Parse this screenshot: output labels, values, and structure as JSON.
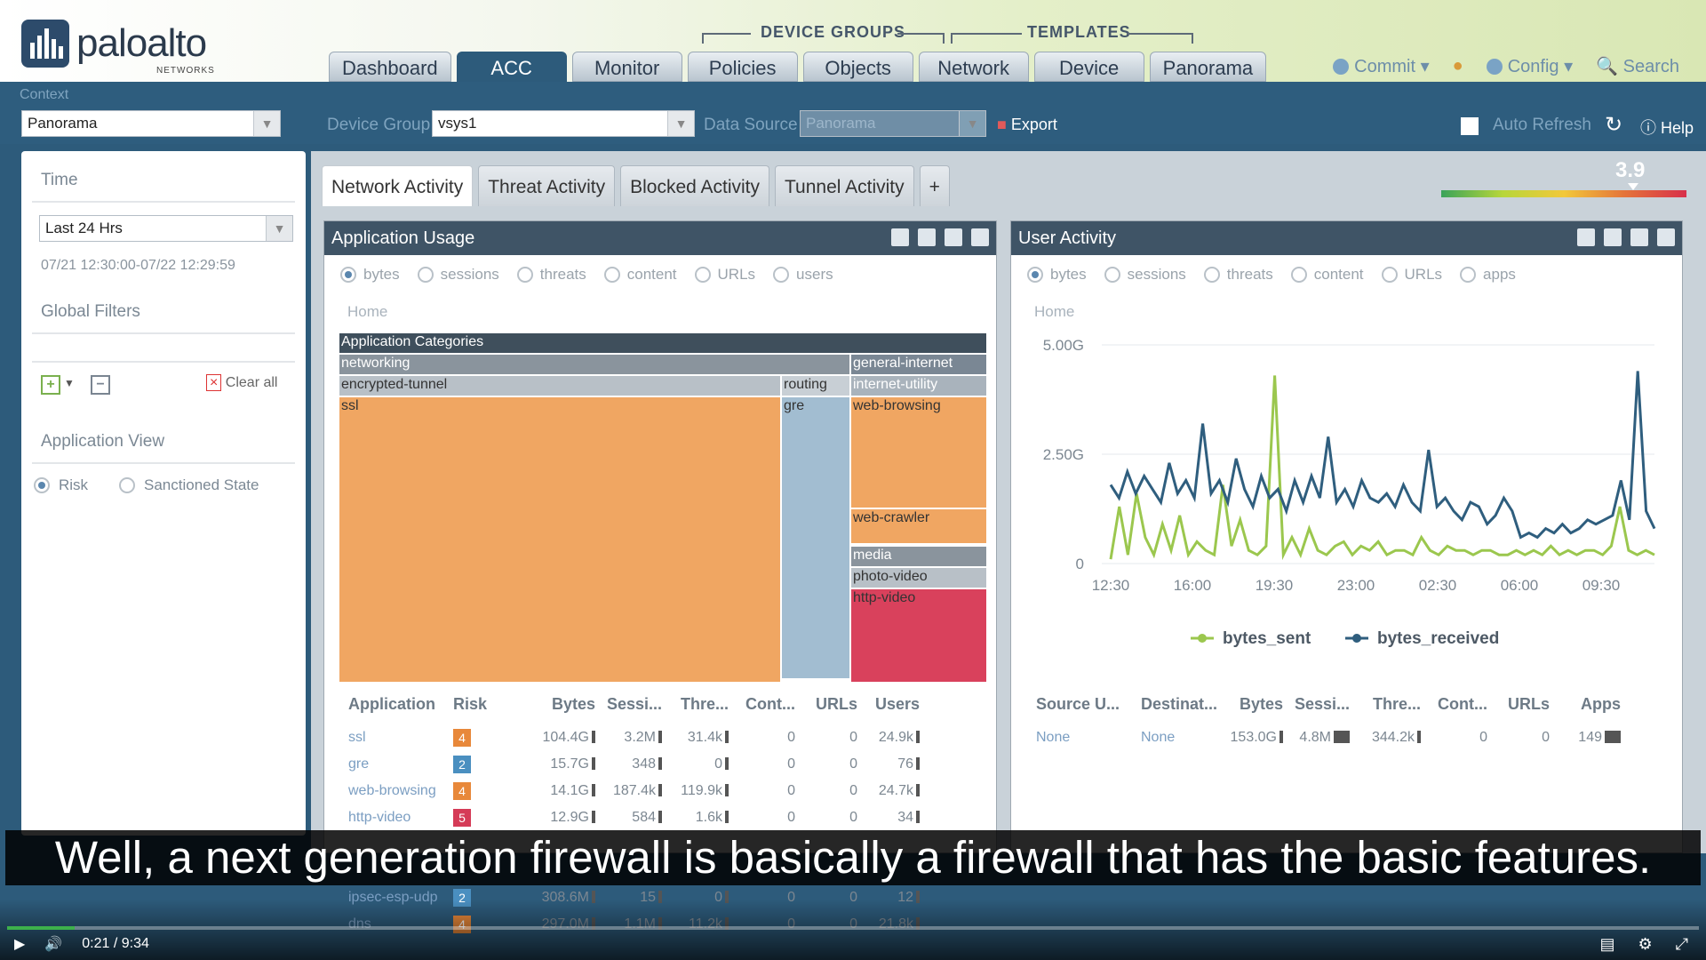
{
  "logo": {
    "name": "paloalto",
    "sub": "NETWORKS"
  },
  "groups": {
    "device_groups": "DEVICE GROUPS",
    "templates": "TEMPLATES"
  },
  "nav": [
    "Dashboard",
    "ACC",
    "Monitor",
    "Policies",
    "Objects",
    "Network",
    "Device",
    "Panorama"
  ],
  "nav_active": 1,
  "header_actions": {
    "commit": "Commit",
    "config": "Config",
    "search": "Search"
  },
  "context": {
    "label": "Context",
    "value": "Panorama"
  },
  "device_group": {
    "label": "Device Group",
    "value": "vsys1"
  },
  "data_source": {
    "label": "Data Source",
    "value": "Panorama"
  },
  "export_label": "Export",
  "auto_refresh_label": "Auto Refresh",
  "help_label": "Help",
  "left": {
    "time_label": "Time",
    "time_value": "Last 24 Hrs",
    "time_range": "07/21 12:30:00-07/22 12:29:59",
    "filters_label": "Global Filters",
    "clear_all": "Clear all",
    "app_view_label": "Application View",
    "risk": "Risk",
    "sanctioned": "Sanctioned State"
  },
  "subtabs": [
    "Network Activity",
    "Threat Activity",
    "Blocked Activity",
    "Tunnel Activity"
  ],
  "add_tab": "+",
  "risk_score": "3.9",
  "app_usage": {
    "title": "Application Usage",
    "radios": [
      "bytes",
      "sessions",
      "threats",
      "content",
      "URLs",
      "users"
    ],
    "home": "Home",
    "treemap": {
      "title": "Application Categories",
      "networking": "networking",
      "general_internet": "general-internet",
      "encrypted_tunnel": "encrypted-tunnel",
      "routing": "routing",
      "internet_utility": "internet-utility",
      "ssl": "ssl",
      "gre": "gre",
      "web_browsing": "web-browsing",
      "web_crawler": "web-crawler",
      "media": "media",
      "photo_video": "photo-video",
      "http_video": "http-video"
    },
    "columns": [
      "Application",
      "Risk",
      "Bytes",
      "Sessi...",
      "Thre...",
      "Cont...",
      "URLs",
      "Users"
    ],
    "rows": [
      {
        "app": "ssl",
        "risk": "4",
        "bytes": "104.4G",
        "sessions": "3.2M",
        "threats": "31.4k",
        "content": "0",
        "urls": "0",
        "users": "24.9k"
      },
      {
        "app": "gre",
        "risk": "2",
        "bytes": "15.7G",
        "sessions": "348",
        "threats": "0",
        "content": "0",
        "urls": "0",
        "users": "76"
      },
      {
        "app": "web-browsing",
        "risk": "4",
        "bytes": "14.1G",
        "sessions": "187.4k",
        "threats": "119.9k",
        "content": "0",
        "urls": "0",
        "users": "24.7k"
      },
      {
        "app": "http-video",
        "risk": "5",
        "bytes": "12.9G",
        "sessions": "584",
        "threats": "1.6k",
        "content": "0",
        "urls": "0",
        "users": "34"
      },
      {
        "app": "ipsec-esp-udp",
        "risk": "2",
        "bytes": "308.6M",
        "sessions": "15",
        "threats": "0",
        "content": "0",
        "urls": "0",
        "users": "12"
      },
      {
        "app": "dns",
        "risk": "4",
        "bytes": "297.0M",
        "sessions": "1.1M",
        "threats": "11.2k",
        "content": "0",
        "urls": "0",
        "users": "21.8k"
      }
    ]
  },
  "user_activity": {
    "title": "User Activity",
    "radios": [
      "bytes",
      "sessions",
      "threats",
      "content",
      "URLs",
      "apps"
    ],
    "home": "Home",
    "columns": [
      "Source U...",
      "Destinat...",
      "Bytes",
      "Sessi...",
      "Thre...",
      "Cont...",
      "URLs",
      "Apps"
    ],
    "row": {
      "source": "None",
      "dest": "None",
      "bytes": "153.0G",
      "sessions": "4.8M",
      "threats": "344.2k",
      "content": "0",
      "urls": "0",
      "apps": "149"
    }
  },
  "chart_data": {
    "type": "line",
    "x": [
      "12:30",
      "16:00",
      "19:30",
      "23:00",
      "02:30",
      "06:00",
      "09:30"
    ],
    "yticks": [
      "0",
      "2.50G",
      "5.00G"
    ],
    "ylim": [
      0,
      5.0
    ],
    "series": [
      {
        "name": "bytes_sent",
        "color": "#9bc74e",
        "values": [
          0.1,
          1.3,
          0.2,
          1.6,
          0.6,
          0.2,
          0.9,
          0.3,
          1.1,
          0.2,
          0.5,
          0.3,
          0.2,
          1.8,
          0.4,
          1.0,
          0.3,
          0.2,
          0.4,
          4.3,
          0.2,
          0.6,
          0.2,
          0.8,
          0.3,
          0.2,
          0.4,
          0.5,
          0.2,
          0.4,
          0.3,
          0.5,
          0.2,
          0.3,
          0.3,
          0.2,
          0.6,
          0.3,
          0.2,
          0.4,
          0.3,
          0.3,
          0.2,
          0.3,
          0.3,
          0.2,
          0.2,
          0.3,
          0.2,
          0.3,
          0.2,
          0.4,
          0.2,
          0.3,
          0.2,
          0.3,
          0.3,
          0.2,
          0.4,
          1.3,
          0.3,
          0.2,
          0.3,
          0.2
        ]
      },
      {
        "name": "bytes_received",
        "color": "#2f5e7e",
        "values": [
          1.8,
          1.5,
          2.1,
          1.6,
          2.0,
          1.7,
          1.4,
          2.3,
          1.6,
          1.9,
          1.5,
          3.2,
          1.6,
          1.9,
          1.4,
          2.4,
          1.7,
          1.3,
          2.0,
          1.5,
          1.7,
          1.2,
          1.9,
          1.4,
          2.0,
          1.5,
          2.9,
          1.4,
          1.7,
          1.3,
          1.9,
          1.5,
          1.4,
          1.6,
          1.3,
          1.8,
          1.4,
          1.2,
          2.6,
          1.3,
          1.5,
          1.2,
          1.0,
          1.4,
          1.3,
          0.9,
          1.1,
          1.5,
          1.2,
          0.6,
          0.7,
          0.6,
          0.8,
          0.7,
          0.9,
          0.7,
          0.8,
          1.0,
          0.9,
          1.0,
          1.1,
          1.9,
          1.0,
          4.4,
          1.2,
          0.8
        ]
      }
    ]
  },
  "caption": "Well, a next generation firewall is basically a firewall that has the basic features.",
  "player": {
    "time": "0:21",
    "duration": "9:34",
    "progress": 0.04
  }
}
